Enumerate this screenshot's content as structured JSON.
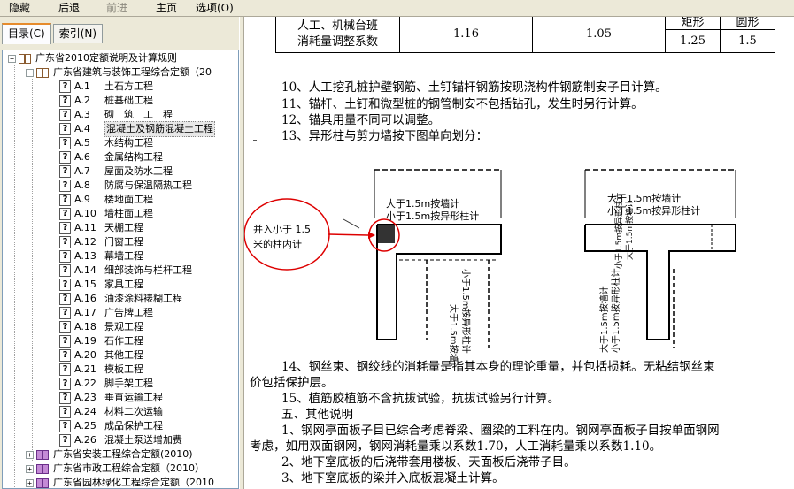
{
  "toolbar": {
    "hide": "隐藏",
    "back": "后退",
    "forward": "前进",
    "home": "主页",
    "options": "选项(O)"
  },
  "tabs": {
    "contents": "目录(C)",
    "index": "索引(N)"
  },
  "tree": {
    "root": "广东省2010定额说明及计算规则",
    "building": "广东省建筑与装饰工程综合定额（20",
    "items": [
      {
        "code": "A.1",
        "label": "土石方工程"
      },
      {
        "code": "A.2",
        "label": "桩基础工程"
      },
      {
        "code": "A.3",
        "label": "砌　筑　工　程"
      },
      {
        "code": "A.4",
        "label": "混凝土及钢筋混凝土工程"
      },
      {
        "code": "A.5",
        "label": "木结构工程"
      },
      {
        "code": "A.6",
        "label": "金属结构工程"
      },
      {
        "code": "A.7",
        "label": "屋面及防水工程"
      },
      {
        "code": "A.8",
        "label": "防腐与保温隔热工程"
      },
      {
        "code": "A.9",
        "label": "楼地面工程"
      },
      {
        "code": "A.10",
        "label": "墙柱面工程"
      },
      {
        "code": "A.11",
        "label": "天棚工程"
      },
      {
        "code": "A.12",
        "label": "门窗工程"
      },
      {
        "code": "A.13",
        "label": "幕墙工程"
      },
      {
        "code": "A.14",
        "label": "细部装饰与栏杆工程"
      },
      {
        "code": "A.15",
        "label": "家具工程"
      },
      {
        "code": "A.16",
        "label": "油漆涂料裱糊工程"
      },
      {
        "code": "A.17",
        "label": "广告牌工程"
      },
      {
        "code": "A.18",
        "label": "景观工程"
      },
      {
        "code": "A.19",
        "label": "石作工程"
      },
      {
        "code": "A.20",
        "label": "其他工程"
      },
      {
        "code": "A.21",
        "label": "模板工程"
      },
      {
        "code": "A.22",
        "label": "脚手架工程"
      },
      {
        "code": "A.23",
        "label": "垂直运输工程"
      },
      {
        "code": "A.24",
        "label": "材料二次运输"
      },
      {
        "code": "A.25",
        "label": "成品保护工程"
      },
      {
        "code": "A.26",
        "label": "混凝土泵送增加费"
      }
    ],
    "installation": "广东省安装工程综合定额(2010)",
    "municipal": "广东省市政工程综合定额（2010）",
    "landscape": "广东省园林绿化工程综合定额（2010"
  },
  "doc": {
    "table": {
      "r1c1": "人工、机械台班",
      "r2c1": "消耗量调整系数",
      "v1": "1.16",
      "v2": "1.05",
      "h_rect": "矩形",
      "h_round": "圆形",
      "v_rect": "1.25",
      "v_round": "1.5"
    },
    "lines": [
      "10、人工挖孔桩护壁钢筋、土钉锚杆钢筋按现浇构件钢筋制安子目计算。",
      "11、锚杆、土钉和微型桩的钢管制安不包括钻孔，发生时另行计算。",
      "12、锚具用量不同可以调整。",
      "13、异形柱与剪力墙按下图单向划分："
    ],
    "figure": {
      "callout": [
        "并入小于 1.5",
        "米的柱内计"
      ],
      "left_top": [
        "大于1.5m按墙计",
        "小于1.5m按异形柱计"
      ],
      "left_vert_a": "大于1.5m按墙计",
      "left_vert_b": "小于1.5m按异形柱计",
      "right_top": [
        "大于1.5m按墙计",
        "小于1.5m按异形柱计"
      ],
      "right_vert_a": "小于1.5m按异形柱计",
      "right_vert_b": "大于1.5m按墙计",
      "stem_a": "大于1.5m按墙计",
      "stem_b": "小于1.5m按异形柱计"
    },
    "lines2": [
      "14、钢丝束、钢绞线的消耗量是指其本身的理论重量，并包括损耗。无粘结钢丝束",
      "价包括保护层。",
      "15、植筋胶植筋不含抗拔试验，抗拔试验另行计算。",
      "五、其他说明",
      "1、钢网亭面板子目已综合考虑脊梁、圈梁的工料在内。钢网亭面板子目按单面钢网",
      "考虑，如用双面钢网，钢网消耗量乘以系数1.70，人工消耗量乘以系数1.10。",
      "2、地下室底板的后浇带套用楼板、天面板后浇带子目。",
      "3、地下室底板的梁并入底板混凝土计算。"
    ]
  }
}
